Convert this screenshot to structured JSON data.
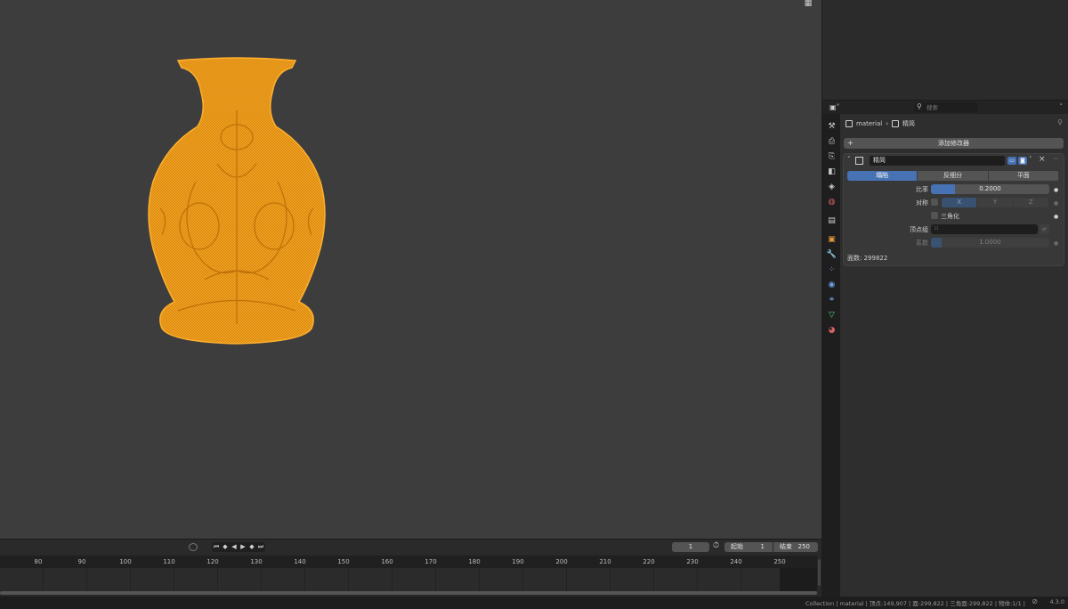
{
  "viewport": {
    "grid_icon": "grid-icon"
  },
  "properties": {
    "search_placeholder": "搜索",
    "editor_icon": "properties-editor-icon",
    "breadcrumb": {
      "object": "material",
      "modifier": "精简"
    },
    "add_modifier_label": "添加修改器",
    "modifier": {
      "name": "精简",
      "tabs": [
        "塌陷",
        "反细分",
        "平面"
      ],
      "active_tab": "塌陷",
      "ratio_label": "比率",
      "ratio_value": "0.2000",
      "ratio_fraction": 0.2,
      "symmetry_label": "对称",
      "axes": [
        "X",
        "Y",
        "Z"
      ],
      "triangulate_label": "三角化",
      "vertex_group_label": "顶点组",
      "factor_label": "系数",
      "factor_value": "1.0000",
      "face_count": "面数: 299822"
    }
  },
  "timeline": {
    "current_frame": "1",
    "start_label": "起始",
    "start_value": "1",
    "end_label": "结束",
    "end_value": "250",
    "ticks": [
      "80",
      "90",
      "100",
      "110",
      "120",
      "130",
      "140",
      "150",
      "160",
      "170",
      "180",
      "190",
      "200",
      "210",
      "220",
      "230",
      "240",
      "250"
    ]
  },
  "statusbar": {
    "text": "Collection | material | 顶点:149,907 | 面:299,822 | 三角面:299,822 | 物体:1/1 |",
    "version": "4.3.0"
  },
  "colors": {
    "accent": "#4772b3",
    "vase": "#f5a623",
    "viewport_bg": "#3d3d3d"
  }
}
